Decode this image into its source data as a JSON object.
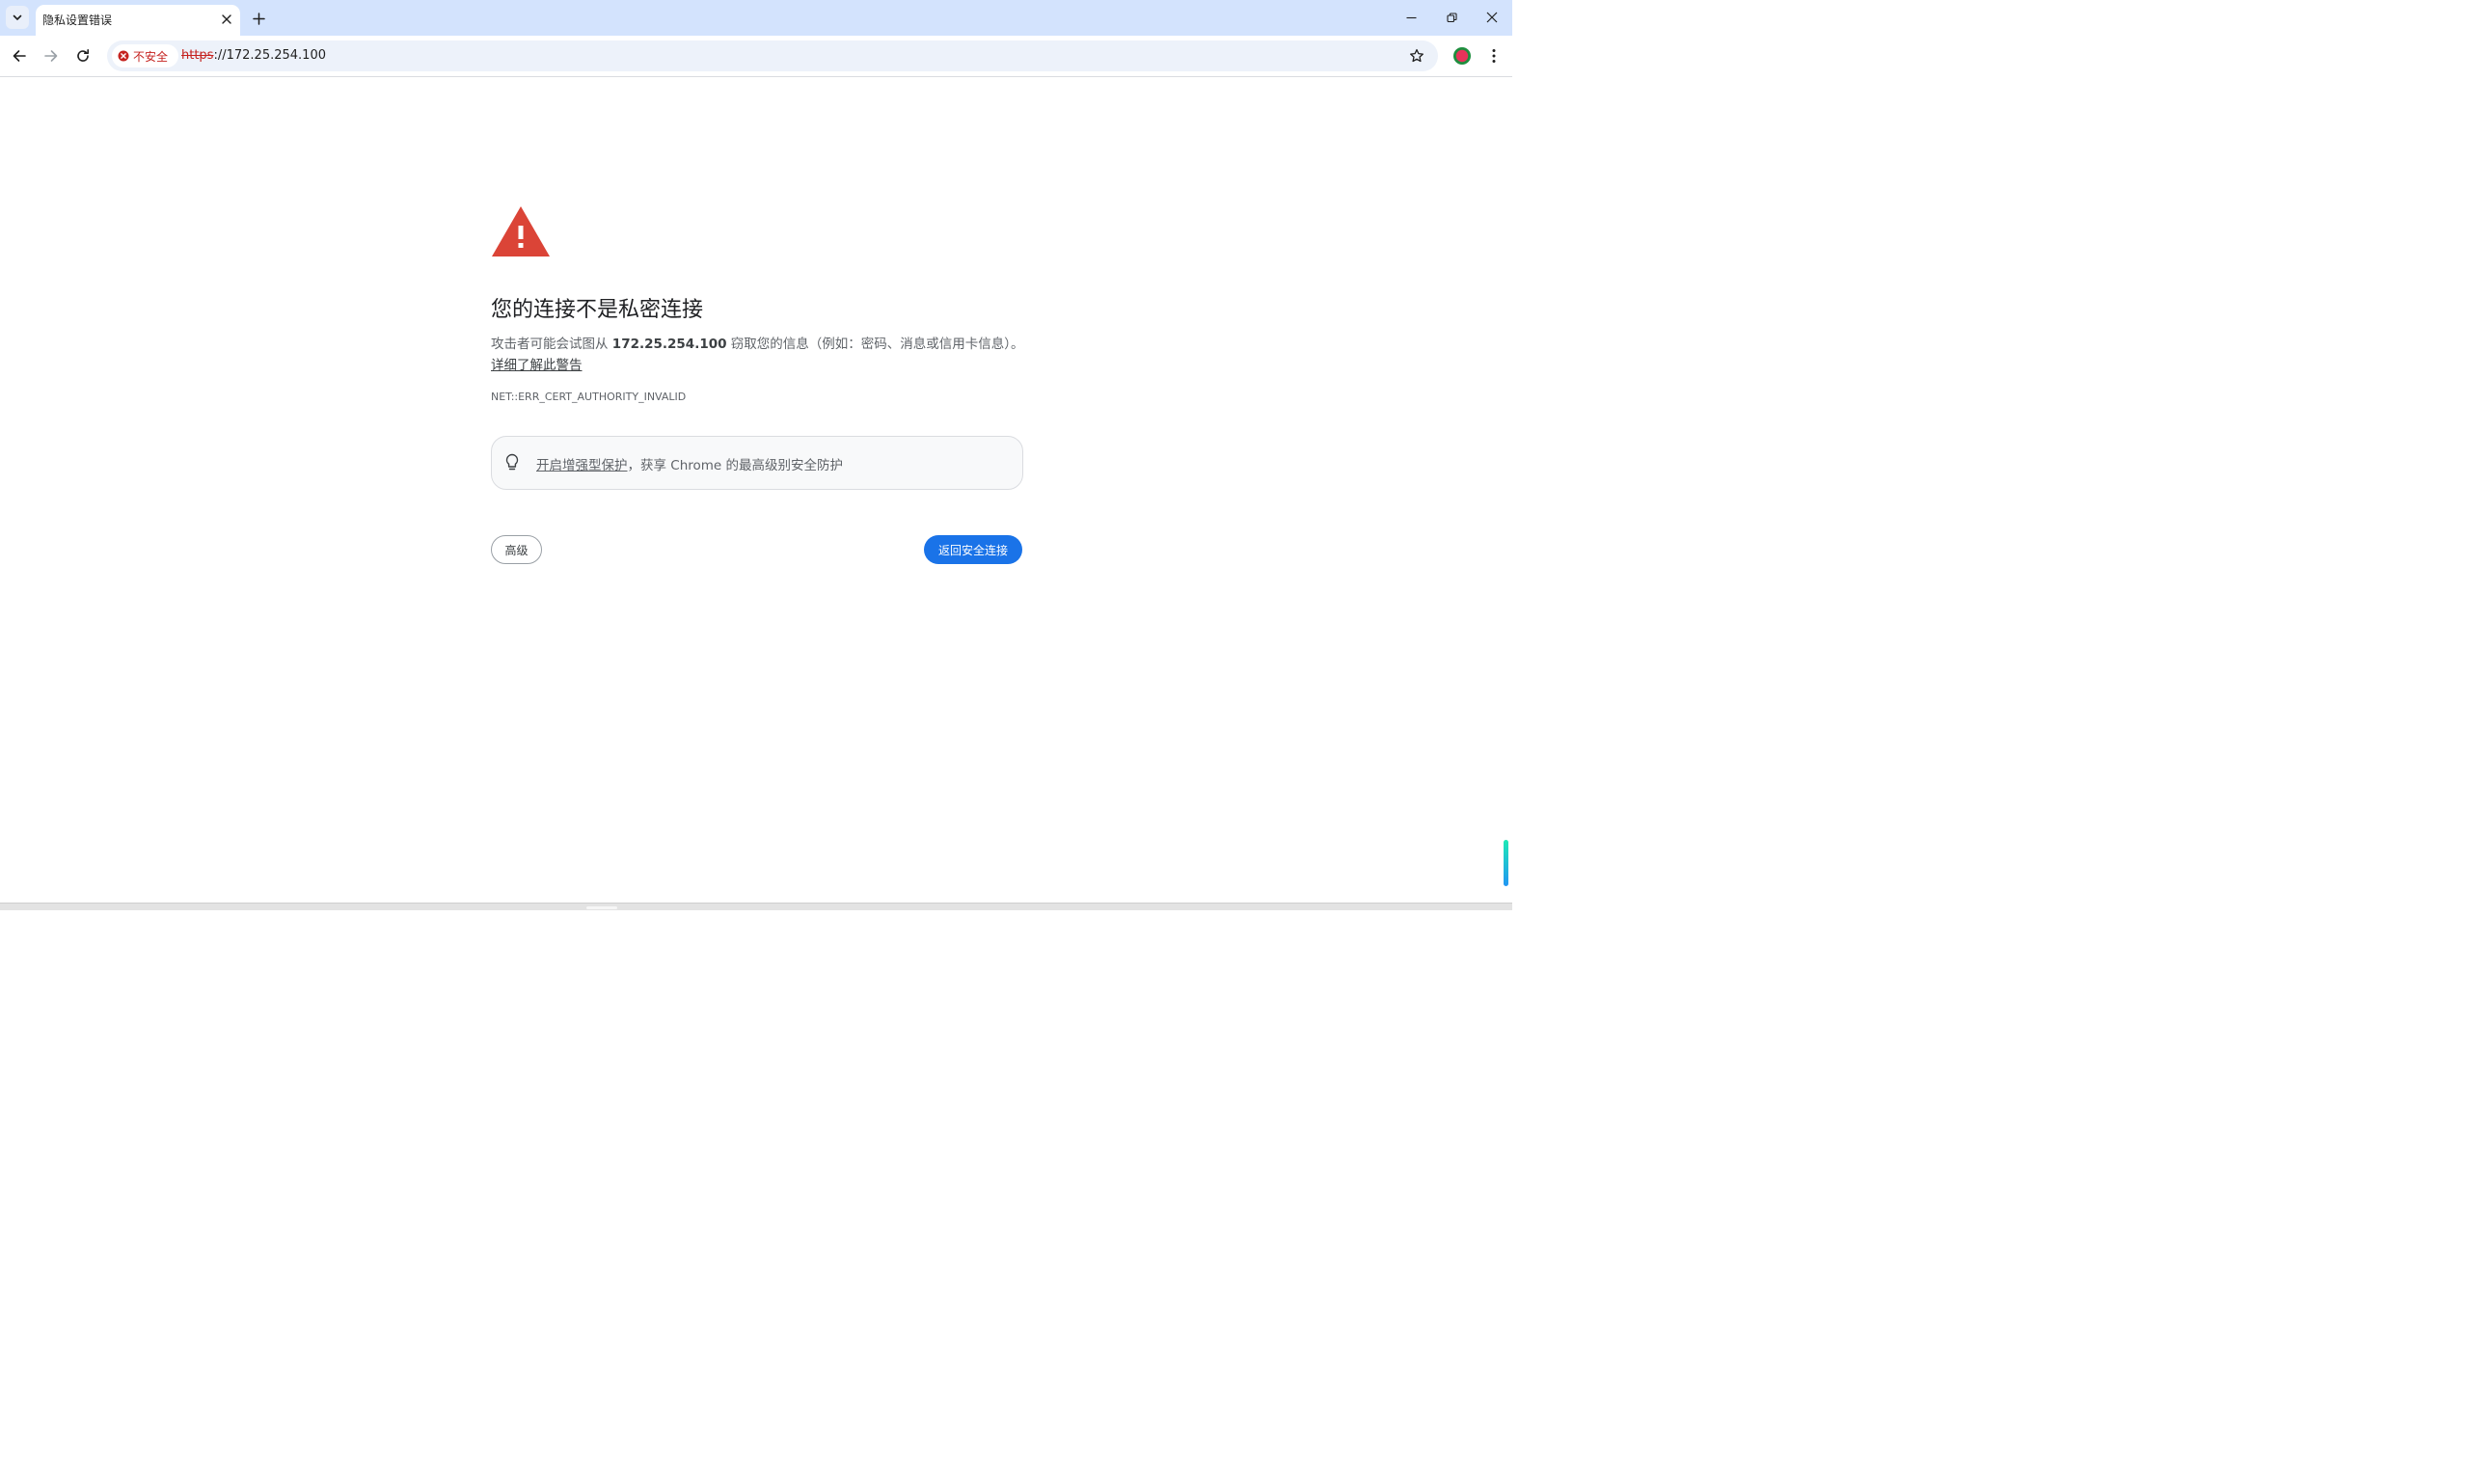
{
  "browser": {
    "tab": {
      "title": "隐私设置错误"
    },
    "toolbar": {
      "security_chip_label": "不安全",
      "url_scheme": "https",
      "url_rest": "://172.25.254.100"
    }
  },
  "page": {
    "headline": "您的连接不是私密连接",
    "description_before": "攻击者可能会试图从 ",
    "host": "172.25.254.100",
    "description_after": " 窃取您的信息（例如：密码、消息或信用卡信息）。",
    "learn_more": "详细了解此警告",
    "error_code": "NET::ERR_CERT_AUTHORITY_INVALID",
    "promo_link": "开启增强型保护",
    "promo_text": "，获享 Chrome 的最高级别安全防护",
    "advanced_button": "高级",
    "back_button": "返回安全连接"
  },
  "icons": {
    "tab_search": "chevron-down-icon",
    "tab_close": "close-icon",
    "new_tab": "plus-icon",
    "minimize": "minimize-icon",
    "restore": "restore-icon",
    "window_close": "close-icon",
    "back": "arrow-left-icon",
    "forward": "arrow-right-icon",
    "reload": "reload-icon",
    "not_secure": "error-circle-icon",
    "bookmark": "star-icon",
    "profile": "profile-avatar-icon",
    "menu": "kebab-menu-icon",
    "warning": "warning-triangle-icon",
    "promo": "lightbulb-icon"
  },
  "colors": {
    "tabstrip_bg": "#d3e3fd",
    "omnibox_bg": "#edf2fa",
    "danger_red": "#c5221f",
    "warning_red": "#db4437",
    "primary_blue": "#1a73e8",
    "text_primary": "#202124",
    "text_secondary": "#5f6368"
  }
}
